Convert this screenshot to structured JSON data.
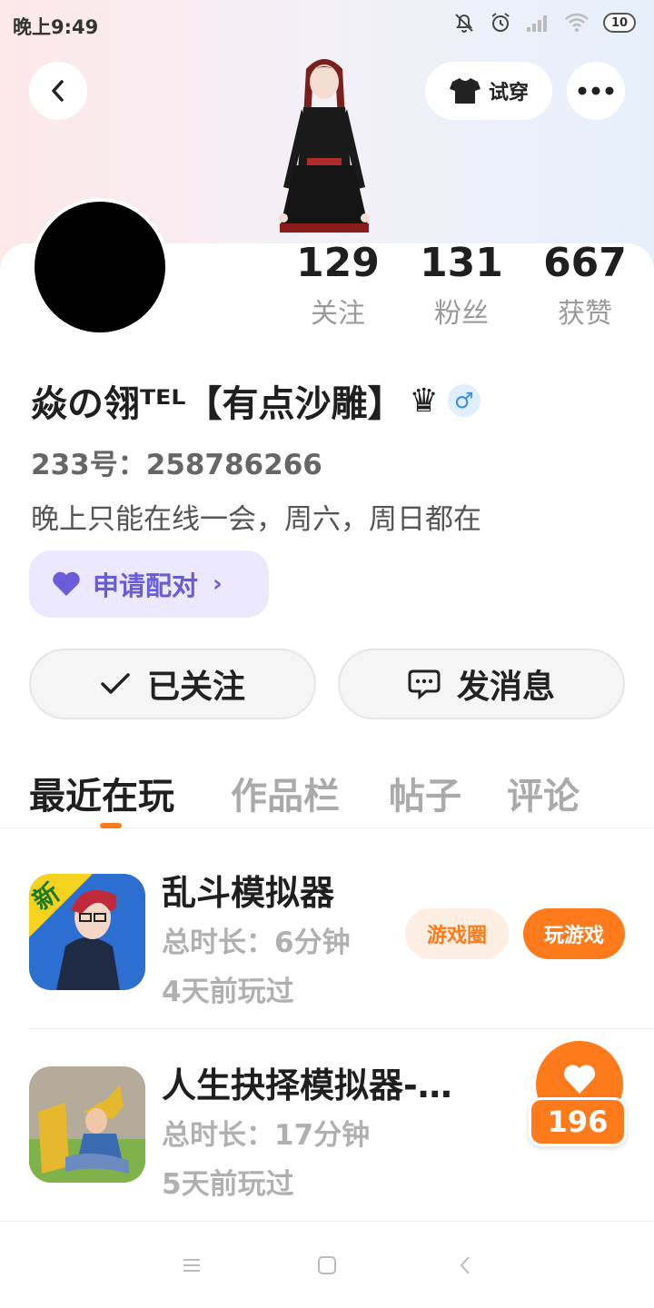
{
  "status_bar": {
    "time": "晚上9:49",
    "battery": "10",
    "icons": [
      "mute-bell-icon",
      "alarm-icon",
      "signal-icon",
      "wifi-icon",
      "battery-icon"
    ]
  },
  "header": {
    "back_icon": "chevron-left-icon",
    "tryon_label": "试穿",
    "tryon_icon": "tshirt-icon",
    "more_icon": "ellipsis-icon"
  },
  "profile": {
    "stats": [
      {
        "value": "129",
        "label": "关注"
      },
      {
        "value": "131",
        "label": "粉丝"
      },
      {
        "value": "667",
        "label": "获赞"
      }
    ],
    "nickname": "焱の翎ᵀᴱᴸ【有点沙雕】",
    "crown": "♛",
    "gender_symbol": "♂",
    "uid": "233号：258786266",
    "bio": "晚上只能在线一会，周六，周日都在",
    "pair_label": "申请配对",
    "follow_label": "已关注",
    "message_label": "发消息"
  },
  "tabs": [
    {
      "label": "最近在玩",
      "active": true
    },
    {
      "label": "作品栏",
      "active": false
    },
    {
      "label": "帖子",
      "active": false
    },
    {
      "label": "评论",
      "active": false
    }
  ],
  "games": [
    {
      "title": "乱斗模拟器",
      "duration": "总时长：6分钟",
      "last_played": "4天前玩过",
      "circle_label": "游戏圈",
      "play_label": "玩游戏",
      "badge": "新"
    },
    {
      "title": "人生抉择模拟器-…",
      "duration": "总时长：17分钟",
      "last_played": "5天前玩过"
    }
  ],
  "like_float": {
    "count": "196",
    "icon": "heart-icon"
  },
  "colors": {
    "accent": "#ff7a1a",
    "pair": "#6a5cd8",
    "gender": "#3a8be6"
  },
  "navbar": {
    "icons": [
      "menu-icon",
      "home-square-icon",
      "back-triangle-icon"
    ]
  }
}
